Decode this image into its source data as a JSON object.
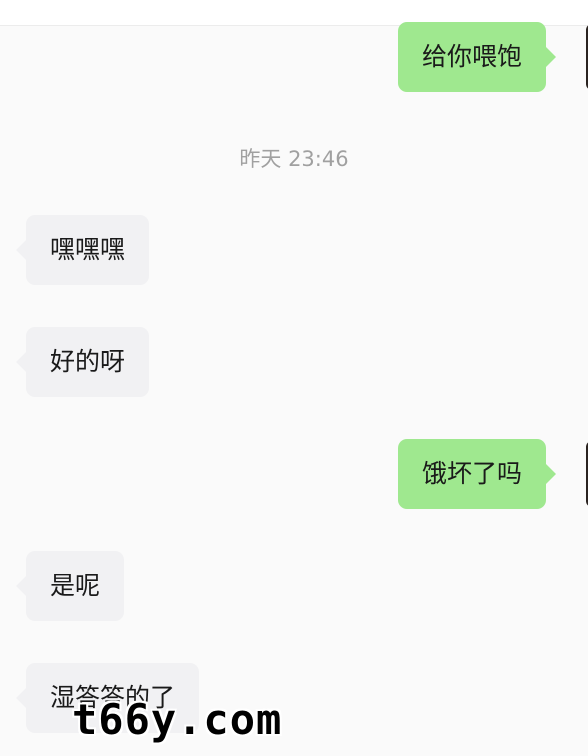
{
  "timestamp": "昨天 23:46",
  "messages": [
    {
      "side": "sent",
      "text": "给你喂饱"
    },
    {
      "side": "received",
      "text": "嘿嘿嘿"
    },
    {
      "side": "received",
      "text": "好的呀"
    },
    {
      "side": "sent",
      "text": "饿坏了吗"
    },
    {
      "side": "received",
      "text": "是呢"
    },
    {
      "side": "received",
      "text": "湿答答的了"
    }
  ],
  "watermark": "t66y.com",
  "colors": {
    "sent_bubble": "#9fe88f",
    "received_bubble": "#f1f1f3",
    "background": "#fafafa",
    "timestamp_text": "#a0a0a0"
  }
}
